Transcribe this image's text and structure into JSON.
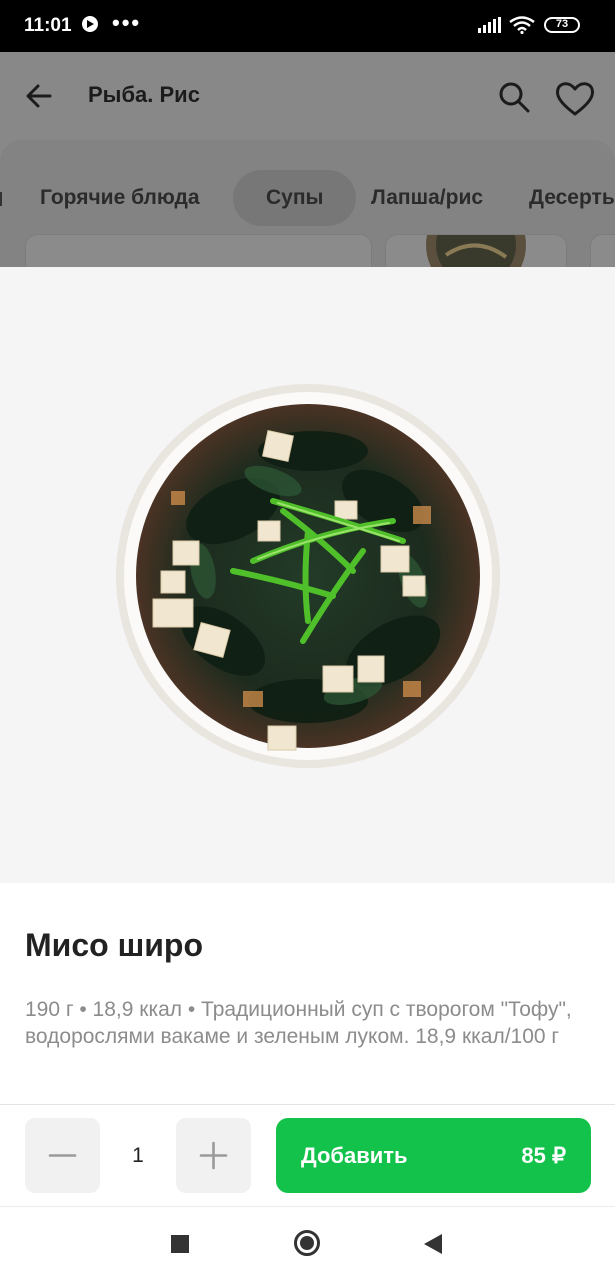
{
  "status_bar": {
    "time": "11:01",
    "battery": "73",
    "notif_dots": "•••"
  },
  "app_bar": {
    "title": "Рыба. Рис"
  },
  "category_tabs": [
    {
      "label": "Горячие блюда",
      "active": false
    },
    {
      "label": "Супы",
      "active": true
    },
    {
      "label": "Лапша/рис",
      "active": false
    },
    {
      "label": "Десерты",
      "active": false
    }
  ],
  "product": {
    "title": "Мисо широ",
    "description": "190 г • 18,9 ккал • Традиционный суп с творогом \"Тофу\", водорослями вакаме и зеленым луком. 18,9 ккал/100 г",
    "quantity": "1",
    "add_label": "Добавить",
    "price": "85 ₽"
  },
  "colors": {
    "accent": "#13c24a",
    "overlay": "#888888",
    "photo_bg": "#f5f5f5"
  }
}
